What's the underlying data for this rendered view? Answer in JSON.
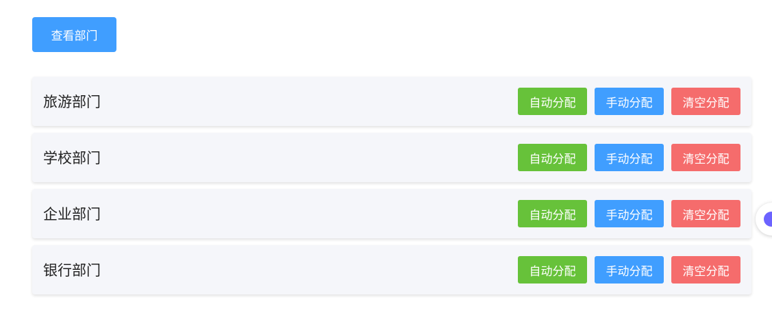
{
  "toolbar": {
    "view_label": "查看部门"
  },
  "departments": [
    {
      "name": "旅游部门",
      "auto_label": "自动分配",
      "manual_label": "手动分配",
      "clear_label": "清空分配"
    },
    {
      "name": "学校部门",
      "auto_label": "自动分配",
      "manual_label": "手动分配",
      "clear_label": "清空分配"
    },
    {
      "name": "企业部门",
      "auto_label": "自动分配",
      "manual_label": "手动分配",
      "clear_label": "清空分配"
    },
    {
      "name": "银行部门",
      "auto_label": "自动分配",
      "manual_label": "手动分配",
      "clear_label": "清空分配"
    }
  ],
  "floating_widget": {
    "icon": "assistant-icon"
  },
  "colors": {
    "primary": "#409eff",
    "success": "#67c23a",
    "danger": "#f56c6c",
    "row_bg": "#f5f6fa"
  }
}
